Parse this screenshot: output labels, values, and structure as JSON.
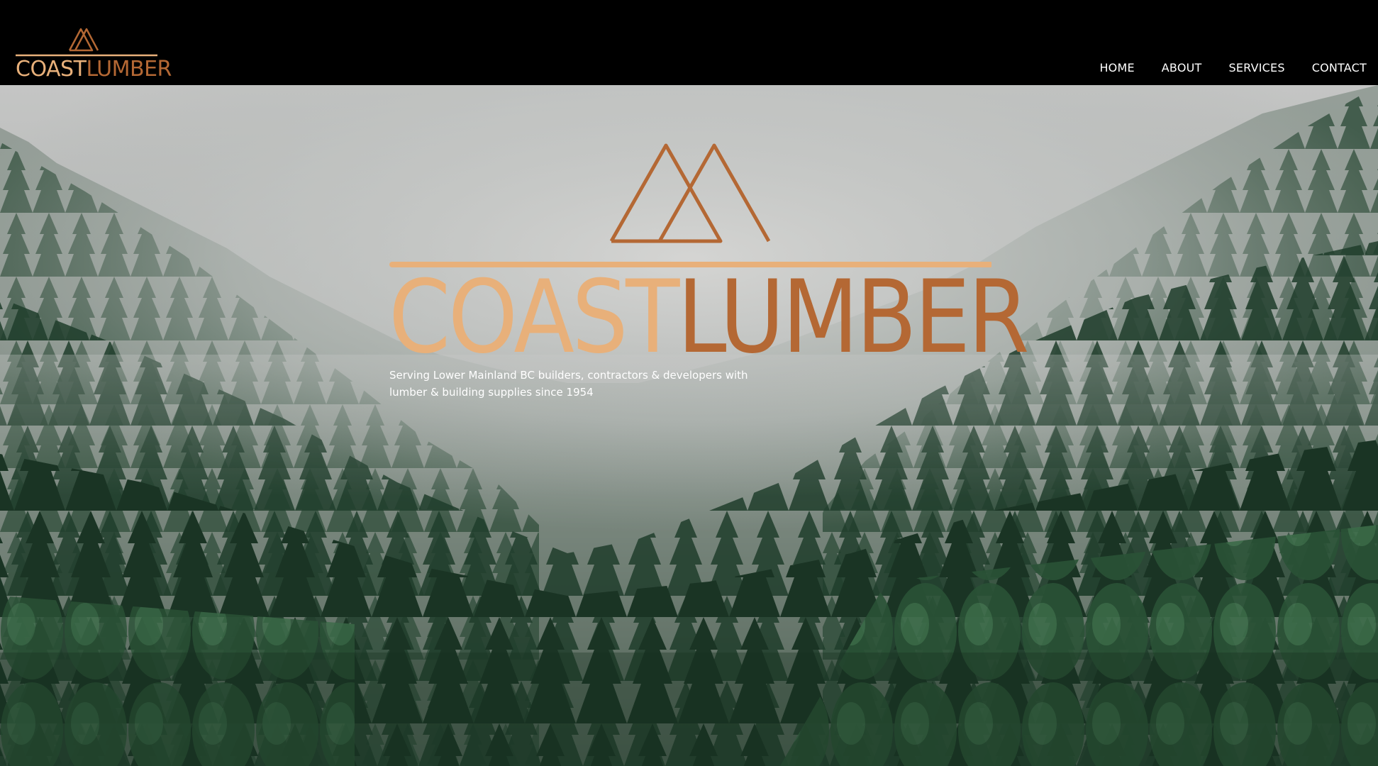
{
  "brand": {
    "name_part1": "COAST",
    "name_part2": "LUMBER",
    "colors": {
      "light": "#e8b07a",
      "dark": "#b46834",
      "header_bg": "#000000"
    }
  },
  "nav": {
    "items": [
      {
        "label": "HOME"
      },
      {
        "label": "ABOUT"
      },
      {
        "label": "SERVICES"
      },
      {
        "label": "CONTACT"
      }
    ]
  },
  "hero": {
    "title_part1": "COAST",
    "title_part2": "LUMBER",
    "tagline": "Serving Lower Mainland BC builders, contractors & developers with lumber & building supplies since 1954",
    "background": "misty-forest-image"
  },
  "icons": {
    "logo_mark": "mountains-icon"
  }
}
